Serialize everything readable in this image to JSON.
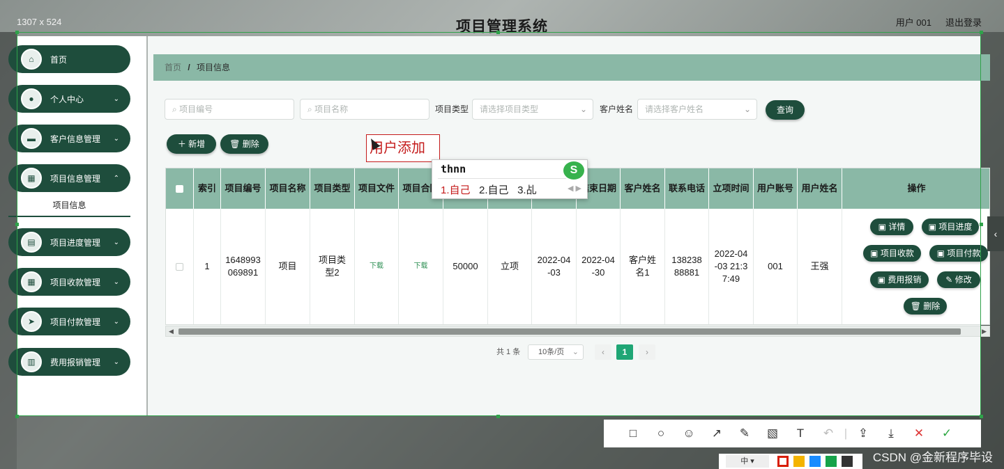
{
  "screenshot": {
    "dimensions_label": "1307 x 524"
  },
  "app": {
    "title": "项目管理系统",
    "user": "用户 001",
    "logout": "退出登录"
  },
  "sidebar": {
    "items": [
      {
        "label": "首页",
        "icon": "home-icon"
      },
      {
        "label": "个人中心",
        "icon": "person-icon"
      },
      {
        "label": "客户信息管理",
        "icon": "customer-icon"
      },
      {
        "label": "项目信息管理",
        "icon": "grid-icon"
      },
      {
        "label": "项目进度管理",
        "icon": "chart-icon"
      },
      {
        "label": "项目收款管理",
        "icon": "grid-icon"
      },
      {
        "label": "项目付款管理",
        "icon": "send-icon"
      },
      {
        "label": "费用报销管理",
        "icon": "bar-chart-icon"
      }
    ],
    "active_sub": "项目信息"
  },
  "breadcrumb": {
    "home": "首页",
    "separator": "/",
    "current": "项目信息"
  },
  "search": {
    "project_no_placeholder": "项目编号",
    "project_name_placeholder": "项目名称",
    "type_label": "项目类型",
    "type_placeholder": "请选择项目类型",
    "customer_label": "客户姓名",
    "customer_placeholder": "请选择客户姓名",
    "query": "查询"
  },
  "actions": {
    "add": "新增",
    "delete": "删除"
  },
  "annotation": {
    "text": "用户添加"
  },
  "ime": {
    "composition": "thnn",
    "candidates": [
      "1.自己",
      "2.自己",
      "3.乩"
    ],
    "logo": "S"
  },
  "table": {
    "headers": [
      "索引",
      "项目编号",
      "项目名称",
      "项目类型",
      "项目文件",
      "项目合同",
      "",
      "",
      "结束日期",
      "客户姓名",
      "联系电话",
      "立项时间",
      "用户账号",
      "用户姓名",
      "操作"
    ],
    "row": {
      "index": "1",
      "project_no": "1648993069891",
      "project_name": "项目",
      "project_type": "项目类型2",
      "file": "下载",
      "contract": "下载",
      "amount": "50000",
      "status": "立项",
      "start_date": "2022-04-03",
      "end_date": "2022-04-30",
      "customer_name": "客户姓名1",
      "phone": "13823888881",
      "created_time": "2022-04-03 21:37:49",
      "user_account": "001",
      "user_name": "王强"
    },
    "ops": [
      "详情",
      "项目进度",
      "项目收款",
      "项目付款",
      "费用报销",
      "修改",
      "删除"
    ]
  },
  "pagination": {
    "total": "共 1 条",
    "page_size": "10条/页",
    "current": "1",
    "prev": "‹",
    "next": "›"
  },
  "toolbar": {
    "icons": [
      "rect-icon",
      "ellipse-icon",
      "mosaic-emoji-icon",
      "arrow-icon",
      "pen-icon",
      "mosaic-icon",
      "text-icon",
      "undo-icon",
      "share-icon",
      "download-icon",
      "close-icon",
      "confirm-icon"
    ]
  },
  "colorbar": {
    "size_label": "中 ▾",
    "colors": [
      "#d81e06",
      "#f4b400",
      "#1a8cff",
      "#16a34a",
      "#333333"
    ]
  },
  "watermark": "CSDN @金新程序毕设"
}
